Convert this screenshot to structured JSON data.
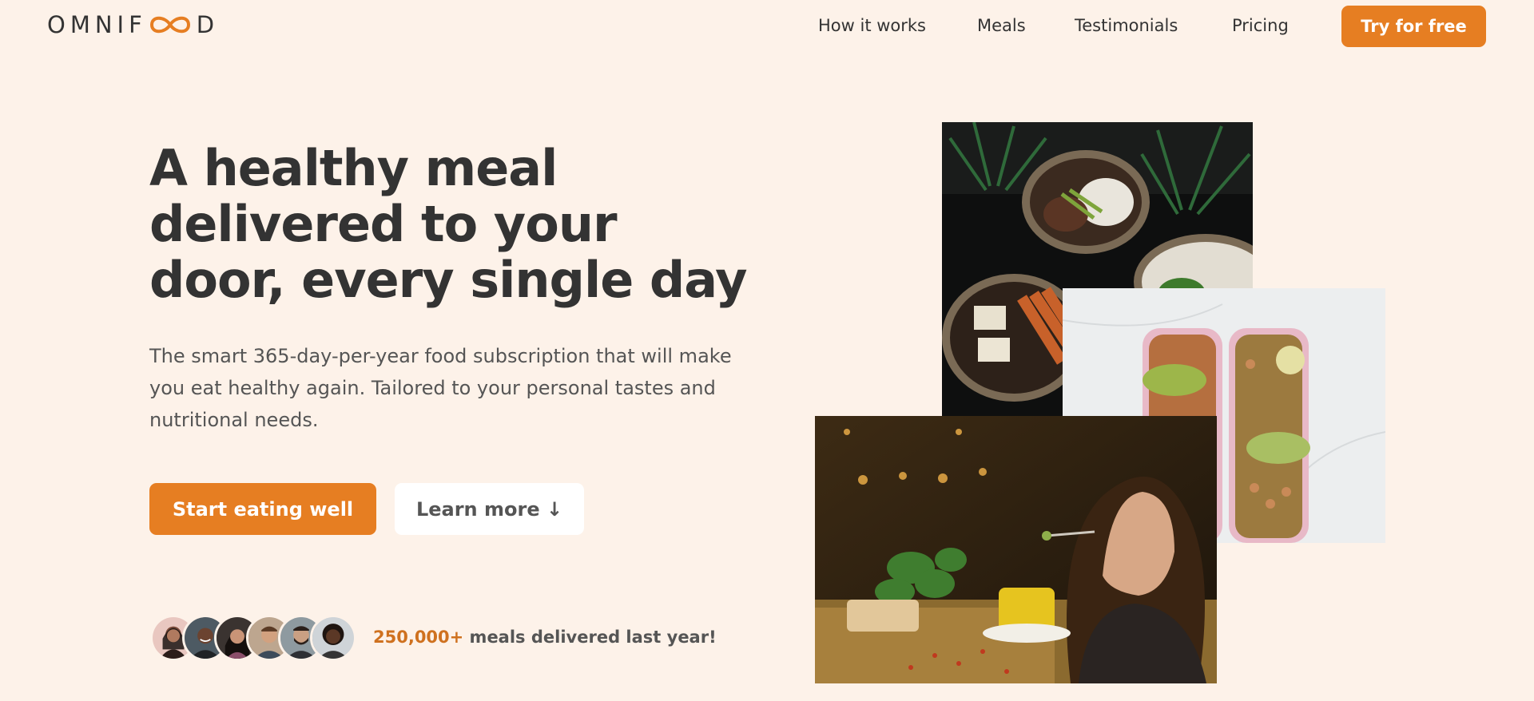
{
  "header": {
    "logo_prefix": "OMNIF",
    "logo_suffix": "D",
    "nav": [
      "How it works",
      "Meals",
      "Testimonials",
      "Pricing"
    ],
    "cta_label": "Try for free"
  },
  "hero": {
    "title_lines": [
      "A healthy meal",
      "delivered to your",
      "door, every single day"
    ],
    "description_lines": [
      "The smart 365-day-per-year food subscription that will make",
      "you eat healthy again. Tailored to your personal tastes and",
      "nutritional needs."
    ],
    "primary_button": "Start eating well",
    "secondary_button": "Learn more ↓"
  },
  "delivered": {
    "count": "250,000+",
    "text": " meals delivered last year!",
    "avatar_count": 6
  },
  "colors": {
    "background": "#fdf2e9",
    "accent": "#e67e22",
    "accent_dark": "#cf711f",
    "text": "#333333"
  }
}
